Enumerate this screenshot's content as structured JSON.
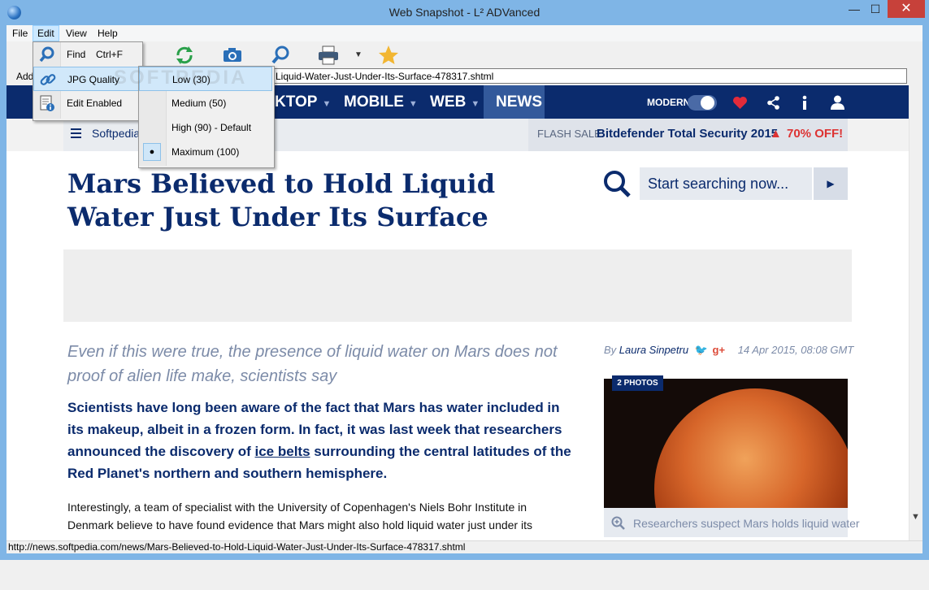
{
  "window": {
    "title": "Web Snapshot - L² ADVanced",
    "minimize": "—",
    "maximize": "☐",
    "close": "✕"
  },
  "menubar": {
    "items": [
      "File",
      "Edit",
      "View",
      "Help"
    ]
  },
  "address": {
    "label": "Add",
    "url": "Liquid-Water-Just-Under-Its-Surface-478317.shtml"
  },
  "edit_menu": {
    "items": [
      {
        "label": "Find",
        "shortcut": "Ctrl+F"
      },
      {
        "label": "JPG Quality"
      },
      {
        "label": "Edit Enabled"
      }
    ]
  },
  "jpg_quality_menu": {
    "items": [
      {
        "label": "Low (30)"
      },
      {
        "label": "Medium (50)"
      },
      {
        "label": "High (90) - Default"
      },
      {
        "label": "Maximum (100)",
        "bullet": "●"
      }
    ]
  },
  "watermark": "SOFTPEDIA",
  "site": {
    "nav": {
      "items": [
        "KTOP",
        "MOBILE",
        "WEB",
        "NEWS"
      ],
      "modern_label": "MODERN"
    },
    "subbar": {
      "home_link": "Softpedia",
      "flash_label": "FLASH SALE:",
      "flash_title": "Bitdefender Total Security 2015",
      "flash_discount": "70% OFF!"
    },
    "article": {
      "headline": "Mars Believed to Hold Liquid Water Just Under Its Surface",
      "dek": "Even if this were true, the presence of liquid water on Mars does not proof of alien life make, scientists say",
      "lead_1": "Scientists have long been aware of the fact that Mars has water included in its makeup, albeit in a frozen form. In fact, it was last week that researchers announced the discovery of ",
      "lead_link": "ice belts",
      "lead_2": " surrounding the central latitudes of the Red Planet's northern and southern hemisphere.",
      "body": "Interestingly, a team of specialist with the University of Copenhagen's Niels Bohr Institute in Denmark believe to have found evidence that Mars might also hold liquid water just under its surface."
    },
    "search": {
      "placeholder": "Start searching now..."
    },
    "byline": {
      "by": "By",
      "author": "Laura Sinpetru",
      "date": "14 Apr 2015, 08:08 GMT"
    },
    "photo": {
      "badge": "2 PHOTOS",
      "caption": "Researchers suspect Mars holds liquid water"
    }
  },
  "statusbar": {
    "text": "http://news.softpedia.com/news/Mars-Believed-to-Hold-Liquid-Water-Just-Under-Its-Surface-478317.shtml"
  },
  "colors": {
    "brand": "#0b2b6d",
    "accent_red": "#d33333",
    "menu_highlight": "#d1e8fa"
  }
}
